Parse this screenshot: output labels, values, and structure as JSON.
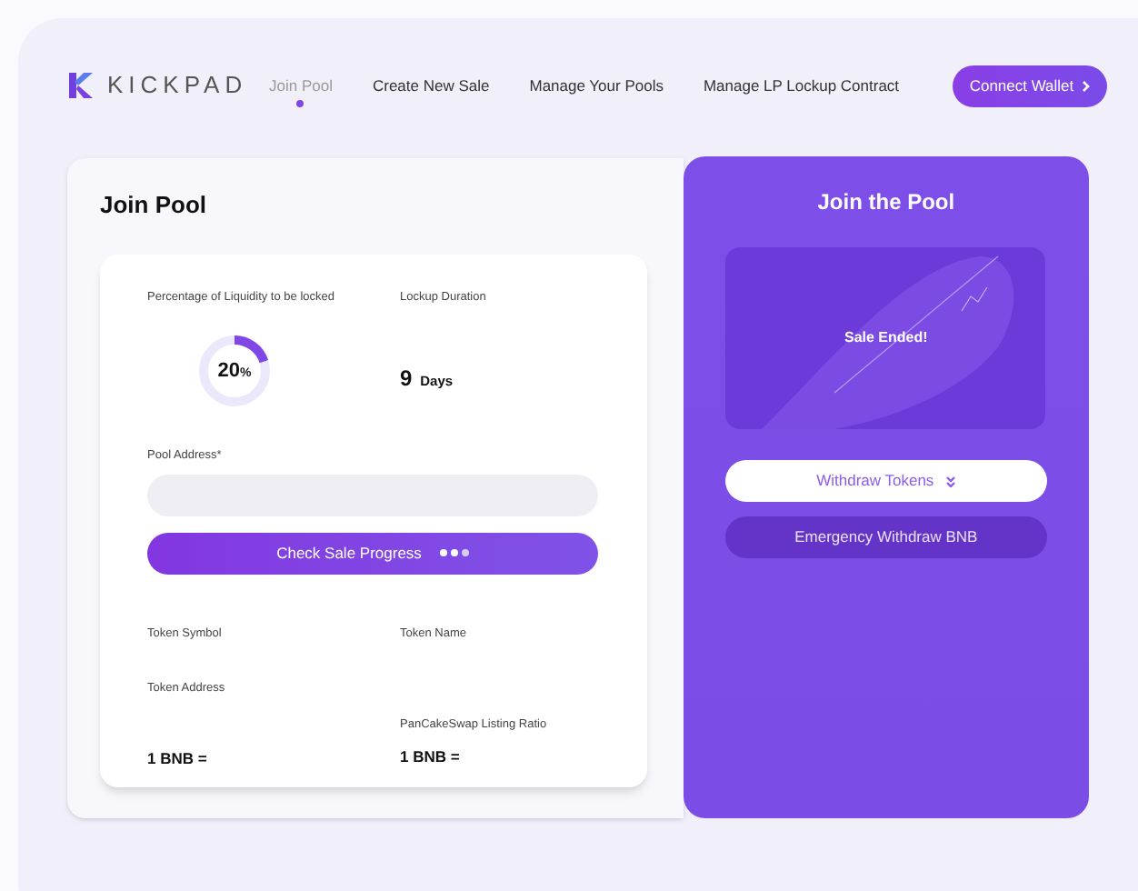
{
  "brand": {
    "name": "KICKPAD"
  },
  "nav": [
    {
      "label": "Join Pool",
      "selected": true
    },
    {
      "label": "Create New Sale",
      "selected": false
    },
    {
      "label": "Manage Your Pools",
      "selected": false
    },
    {
      "label": "Manage LP Lockup Contract",
      "selected": false
    }
  ],
  "connect_button": "Connect Wallet",
  "join_pool": {
    "title": "Join Pool",
    "liquidity": {
      "label": "Percentage of Liquidity to be locked",
      "value": "20",
      "unit": "%",
      "level": 0.2
    },
    "lockup": {
      "label": "Lockup Duration",
      "value": "9",
      "unit": "Days"
    },
    "pool_address": {
      "label": "Pool Address*"
    },
    "check_button": "Check Sale Progress",
    "token_symbol": "Token Symbol",
    "token_name": "Token Name",
    "token_address": "Token Address",
    "listing_ratio_label": "PanCakeSwap Listing Ratio",
    "rate_1": "1 BNB =",
    "rate_2": "1 BNB ="
  },
  "side": {
    "title": "Join the Pool",
    "status": "Sale Ended!",
    "withdraw_button": "Withdraw Tokens",
    "emergency_button": "Emergency Withdraw BNB"
  }
}
